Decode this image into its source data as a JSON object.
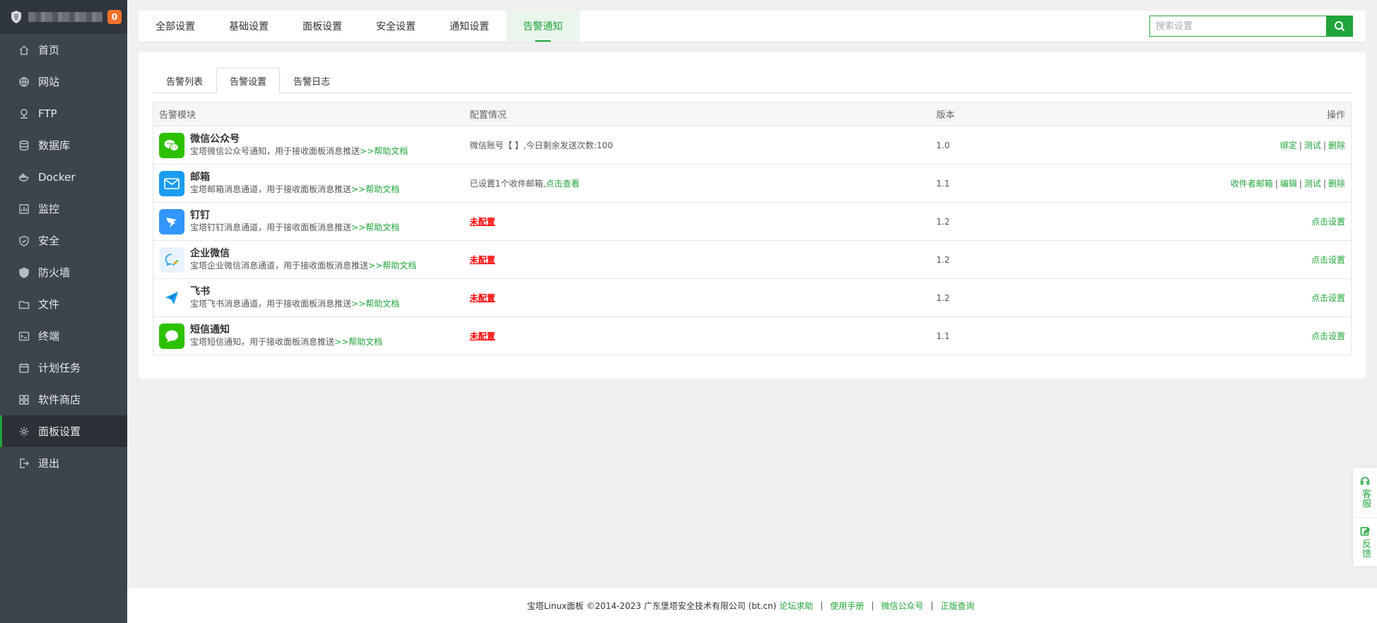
{
  "sidebar": {
    "badge": "0",
    "items": [
      {
        "label": "首页",
        "icon": "home-icon"
      },
      {
        "label": "网站",
        "icon": "globe-icon"
      },
      {
        "label": "FTP",
        "icon": "ftp-icon"
      },
      {
        "label": "数据库",
        "icon": "database-icon"
      },
      {
        "label": "Docker",
        "icon": "docker-icon"
      },
      {
        "label": "监控",
        "icon": "monitor-icon"
      },
      {
        "label": "安全",
        "icon": "shield-check-icon"
      },
      {
        "label": "防火墙",
        "icon": "firewall-icon"
      },
      {
        "label": "文件",
        "icon": "folder-icon"
      },
      {
        "label": "终端",
        "icon": "terminal-icon"
      },
      {
        "label": "计划任务",
        "icon": "calendar-icon"
      },
      {
        "label": "软件商店",
        "icon": "apps-icon"
      },
      {
        "label": "面板设置",
        "icon": "gear-icon"
      },
      {
        "label": "退出",
        "icon": "logout-icon"
      }
    ],
    "active_index": 12
  },
  "topbar": {
    "tabs": [
      "全部设置",
      "基础设置",
      "面板设置",
      "安全设置",
      "通知设置",
      "告警通知"
    ],
    "active_tab": 5,
    "search_placeholder": "搜索设置"
  },
  "subtabs": {
    "items": [
      "告警列表",
      "告警设置",
      "告警日志"
    ],
    "active": 1
  },
  "table": {
    "headers": {
      "module": "告警模块",
      "config": "配置情况",
      "version": "版本",
      "ops": "操作"
    },
    "rows": [
      {
        "name": "微信公众号",
        "desc": "宝塔微信公众号通知，用于接收面板消息推送",
        "help": ">>帮助文档",
        "config": "微信账号【  】,今日剩余发送次数:100",
        "config_link": "",
        "version": "1.0",
        "ops": [
          "绑定",
          "测试",
          "删除"
        ],
        "icon": "wechat-official-icon",
        "color": "#2dc100"
      },
      {
        "name": "邮箱",
        "desc": "宝塔邮箱消息通道，用于接收面板消息推送",
        "help": ">>帮助文档",
        "config": "已设置1个收件邮箱,",
        "config_link": "点击查看",
        "version": "1.1",
        "ops": [
          "收件者邮箱",
          "编辑",
          "测试",
          "删除"
        ],
        "icon": "mail-icon",
        "color": "#1a9cf0"
      },
      {
        "name": "钉钉",
        "desc": "宝塔钉钉消息通道，用于接收面板消息推送",
        "help": ">>帮助文档",
        "config_unset": "未配置",
        "version": "1.2",
        "ops": [
          "点击设置"
        ],
        "icon": "dingtalk-icon",
        "color": "#3296fa"
      },
      {
        "name": "企业微信",
        "desc": "宝塔企业微信消息通道，用于接收面板消息推送",
        "help": ">>帮助文档",
        "config_unset": "未配置",
        "version": "1.2",
        "ops": [
          "点击设置"
        ],
        "icon": "wecom-icon",
        "color": "#e8f3fd"
      },
      {
        "name": "飞书",
        "desc": "宝塔飞书消息通道，用于接收面板消息推送",
        "help": ">>帮助文档",
        "config_unset": "未配置",
        "version": "1.2",
        "ops": [
          "点击设置"
        ],
        "icon": "feishu-icon",
        "color": "#ffffff"
      },
      {
        "name": "短信通知",
        "desc": "宝塔短信通知，用于接收面板消息推送",
        "help": ">>帮助文档",
        "config_unset": "未配置",
        "version": "1.1",
        "ops": [
          "点击设置"
        ],
        "icon": "sms-icon",
        "color": "#2dc100"
      }
    ]
  },
  "float": {
    "service": "客服",
    "feedback": "反馈"
  },
  "footer": {
    "copyright": "宝塔Linux面板 ©2014-2023 广东堡塔安全技术有限公司 (bt.cn)",
    "links": [
      "论坛求助",
      "使用手册",
      "微信公众号",
      "正版查询"
    ]
  },
  "colors": {
    "accent": "#20a53a",
    "sidebar": "#3c444d",
    "danger": "#ff0000",
    "badge": "#f1722b"
  }
}
